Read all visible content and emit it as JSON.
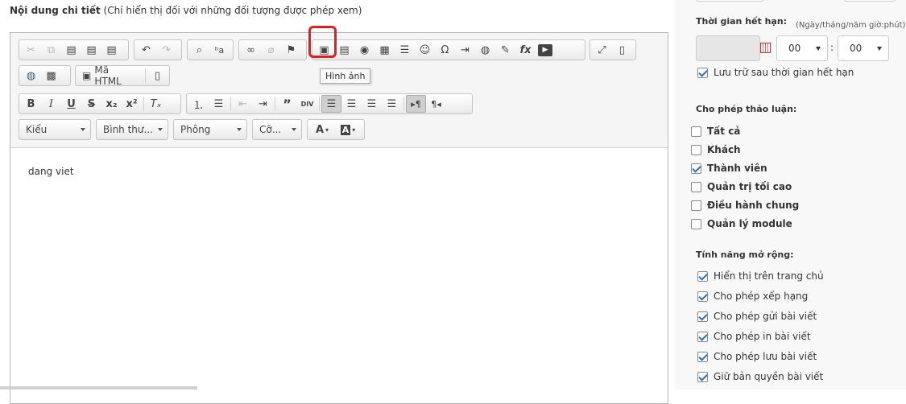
{
  "header": {
    "title": "Nội dung chi tiết",
    "note": "(Chỉ hiển thị đối với những đối tượng được phép xem)"
  },
  "toolbar": {
    "row1": [
      {
        "icon": "cut-icon",
        "glyph": "✂",
        "disabled": true
      },
      {
        "icon": "copy-icon",
        "glyph": "⧉",
        "disabled": true
      },
      {
        "icon": "paste-icon",
        "glyph": "📋"
      },
      {
        "icon": "paste-text-icon",
        "glyph": "📋"
      },
      {
        "icon": "paste-word-icon",
        "glyph": "📋"
      },
      {
        "icon": "undo-icon",
        "glyph": "↶"
      },
      {
        "icon": "redo-icon",
        "glyph": "↷",
        "disabled": true
      },
      {
        "icon": "find-icon",
        "glyph": "🔍"
      },
      {
        "icon": "replace-icon",
        "glyph": "ᵇa"
      },
      {
        "icon": "link-icon",
        "glyph": "🔗"
      },
      {
        "icon": "unlink-icon",
        "glyph": "⛓",
        "disabled": true
      },
      {
        "icon": "anchor-icon",
        "glyph": "⚑"
      },
      {
        "icon": "image-icon",
        "glyph": "▣"
      },
      {
        "icon": "flash-icon",
        "glyph": "▦"
      },
      {
        "icon": "iframe-icon",
        "glyph": "◉"
      },
      {
        "icon": "table-icon",
        "glyph": "▦"
      },
      {
        "icon": "horizontal-rule-icon",
        "glyph": "≡"
      },
      {
        "icon": "smiley-icon",
        "glyph": "☺"
      },
      {
        "icon": "special-char-icon",
        "glyph": "Ω"
      },
      {
        "icon": "page-break-icon",
        "glyph": "⇥"
      },
      {
        "icon": "globe-icon",
        "glyph": "🌐"
      },
      {
        "icon": "code-snippet-icon",
        "glyph": "✎"
      },
      {
        "icon": "formula-icon",
        "glyph": "fx"
      },
      {
        "icon": "youtube-icon",
        "glyph": "▶"
      },
      {
        "icon": "maximize-icon",
        "glyph": "⤢"
      },
      {
        "icon": "show-blocks-icon",
        "glyph": "▯"
      }
    ],
    "row2": {
      "source_label": "Mã HTML"
    },
    "row3_align_pressed": "left",
    "combos": {
      "style": "Kiểu",
      "format": "Bình thư...",
      "font": "Phông",
      "size": "Cỡ..."
    },
    "tooltip": "Hình ảnh"
  },
  "editor": {
    "content": "dang viet"
  },
  "sidebar": {
    "expiry_label": "Thời gian hết hạn:",
    "expiry_hint": "(Ngày/tháng/năm giờ:phút)",
    "hour_value": "00",
    "minute_value": "00",
    "keep_after_expiry": {
      "label": "Lưu trữ sau thời gian hết hạn",
      "checked": true
    },
    "discussion_label": "Cho phép thảo luận:",
    "discussion": [
      {
        "label": "Tất cả",
        "checked": false
      },
      {
        "label": "Khách",
        "checked": false
      },
      {
        "label": "Thành viên",
        "checked": true
      },
      {
        "label": "Quản trị tối cao",
        "checked": false
      },
      {
        "label": "Điều hành chung",
        "checked": false
      },
      {
        "label": "Quản lý module",
        "checked": false
      }
    ],
    "extended_label": "Tính năng mở rộng:",
    "extended": [
      {
        "label": "Hiển thị trên trang chủ",
        "checked": true
      },
      {
        "label": "Cho phép xếp hạng",
        "checked": true
      },
      {
        "label": "Cho phép gửi bài viết",
        "checked": true
      },
      {
        "label": "Cho phép in bài viết",
        "checked": true
      },
      {
        "label": "Cho phép lưu bài viết",
        "checked": true
      },
      {
        "label": "Giữ bản quyền bài viết",
        "checked": true
      }
    ]
  }
}
